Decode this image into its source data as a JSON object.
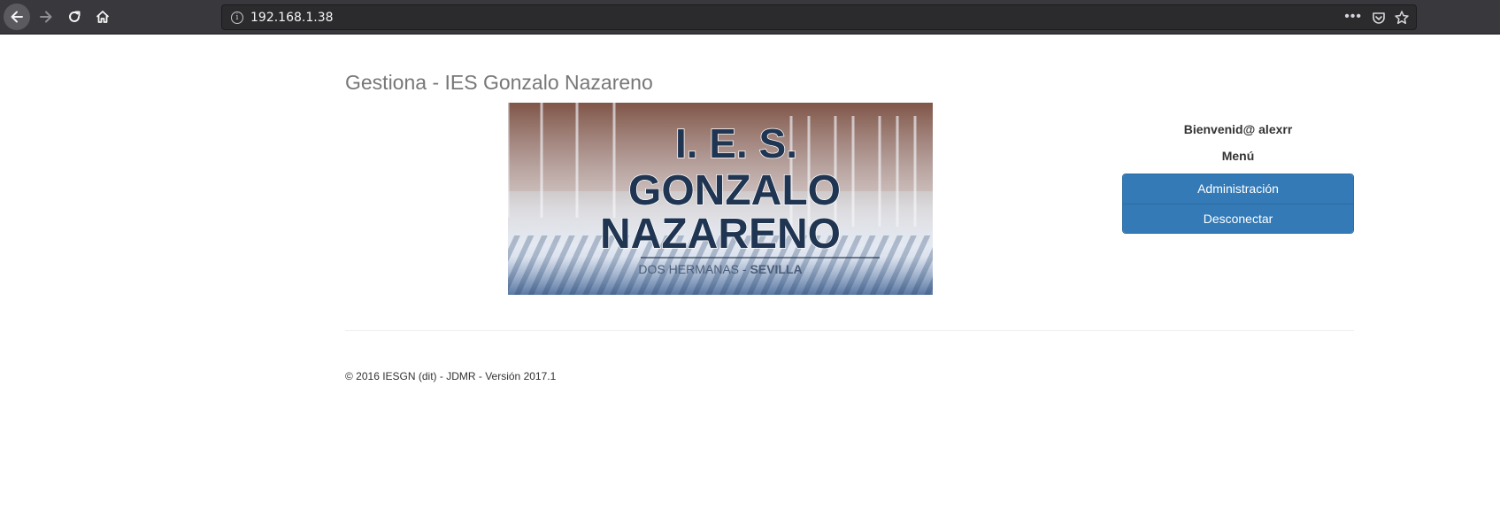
{
  "browser": {
    "url": "192.168.1.38",
    "icons": {
      "back": "arrow-left-icon",
      "forward": "arrow-right-icon",
      "reload": "reload-icon",
      "home": "home-icon",
      "info": "info-icon",
      "page_actions": "more-horizontal-icon",
      "pocket": "pocket-icon",
      "bookmark": "star-icon"
    }
  },
  "page": {
    "title": "Gestiona - IES Gonzalo Nazareno",
    "banner": {
      "line1": "I. E. S.",
      "line2": "GONZALO",
      "line3": "NAZARENO",
      "town": "DOS HERMANAS",
      "separator": " - ",
      "province": "SEVILLA"
    },
    "sidebar": {
      "welcome": "Bienvenid@ alexrr",
      "menu_title": "Menú",
      "items": [
        {
          "label": "Administración"
        },
        {
          "label": "Desconectar"
        }
      ]
    },
    "footer": "© 2016 IESGN (dit) - JDMR - Versión 2017.1"
  },
  "colors": {
    "menu_item_bg": "#337ab7",
    "title_text": "#777777",
    "banner_text": "#1f3552"
  }
}
